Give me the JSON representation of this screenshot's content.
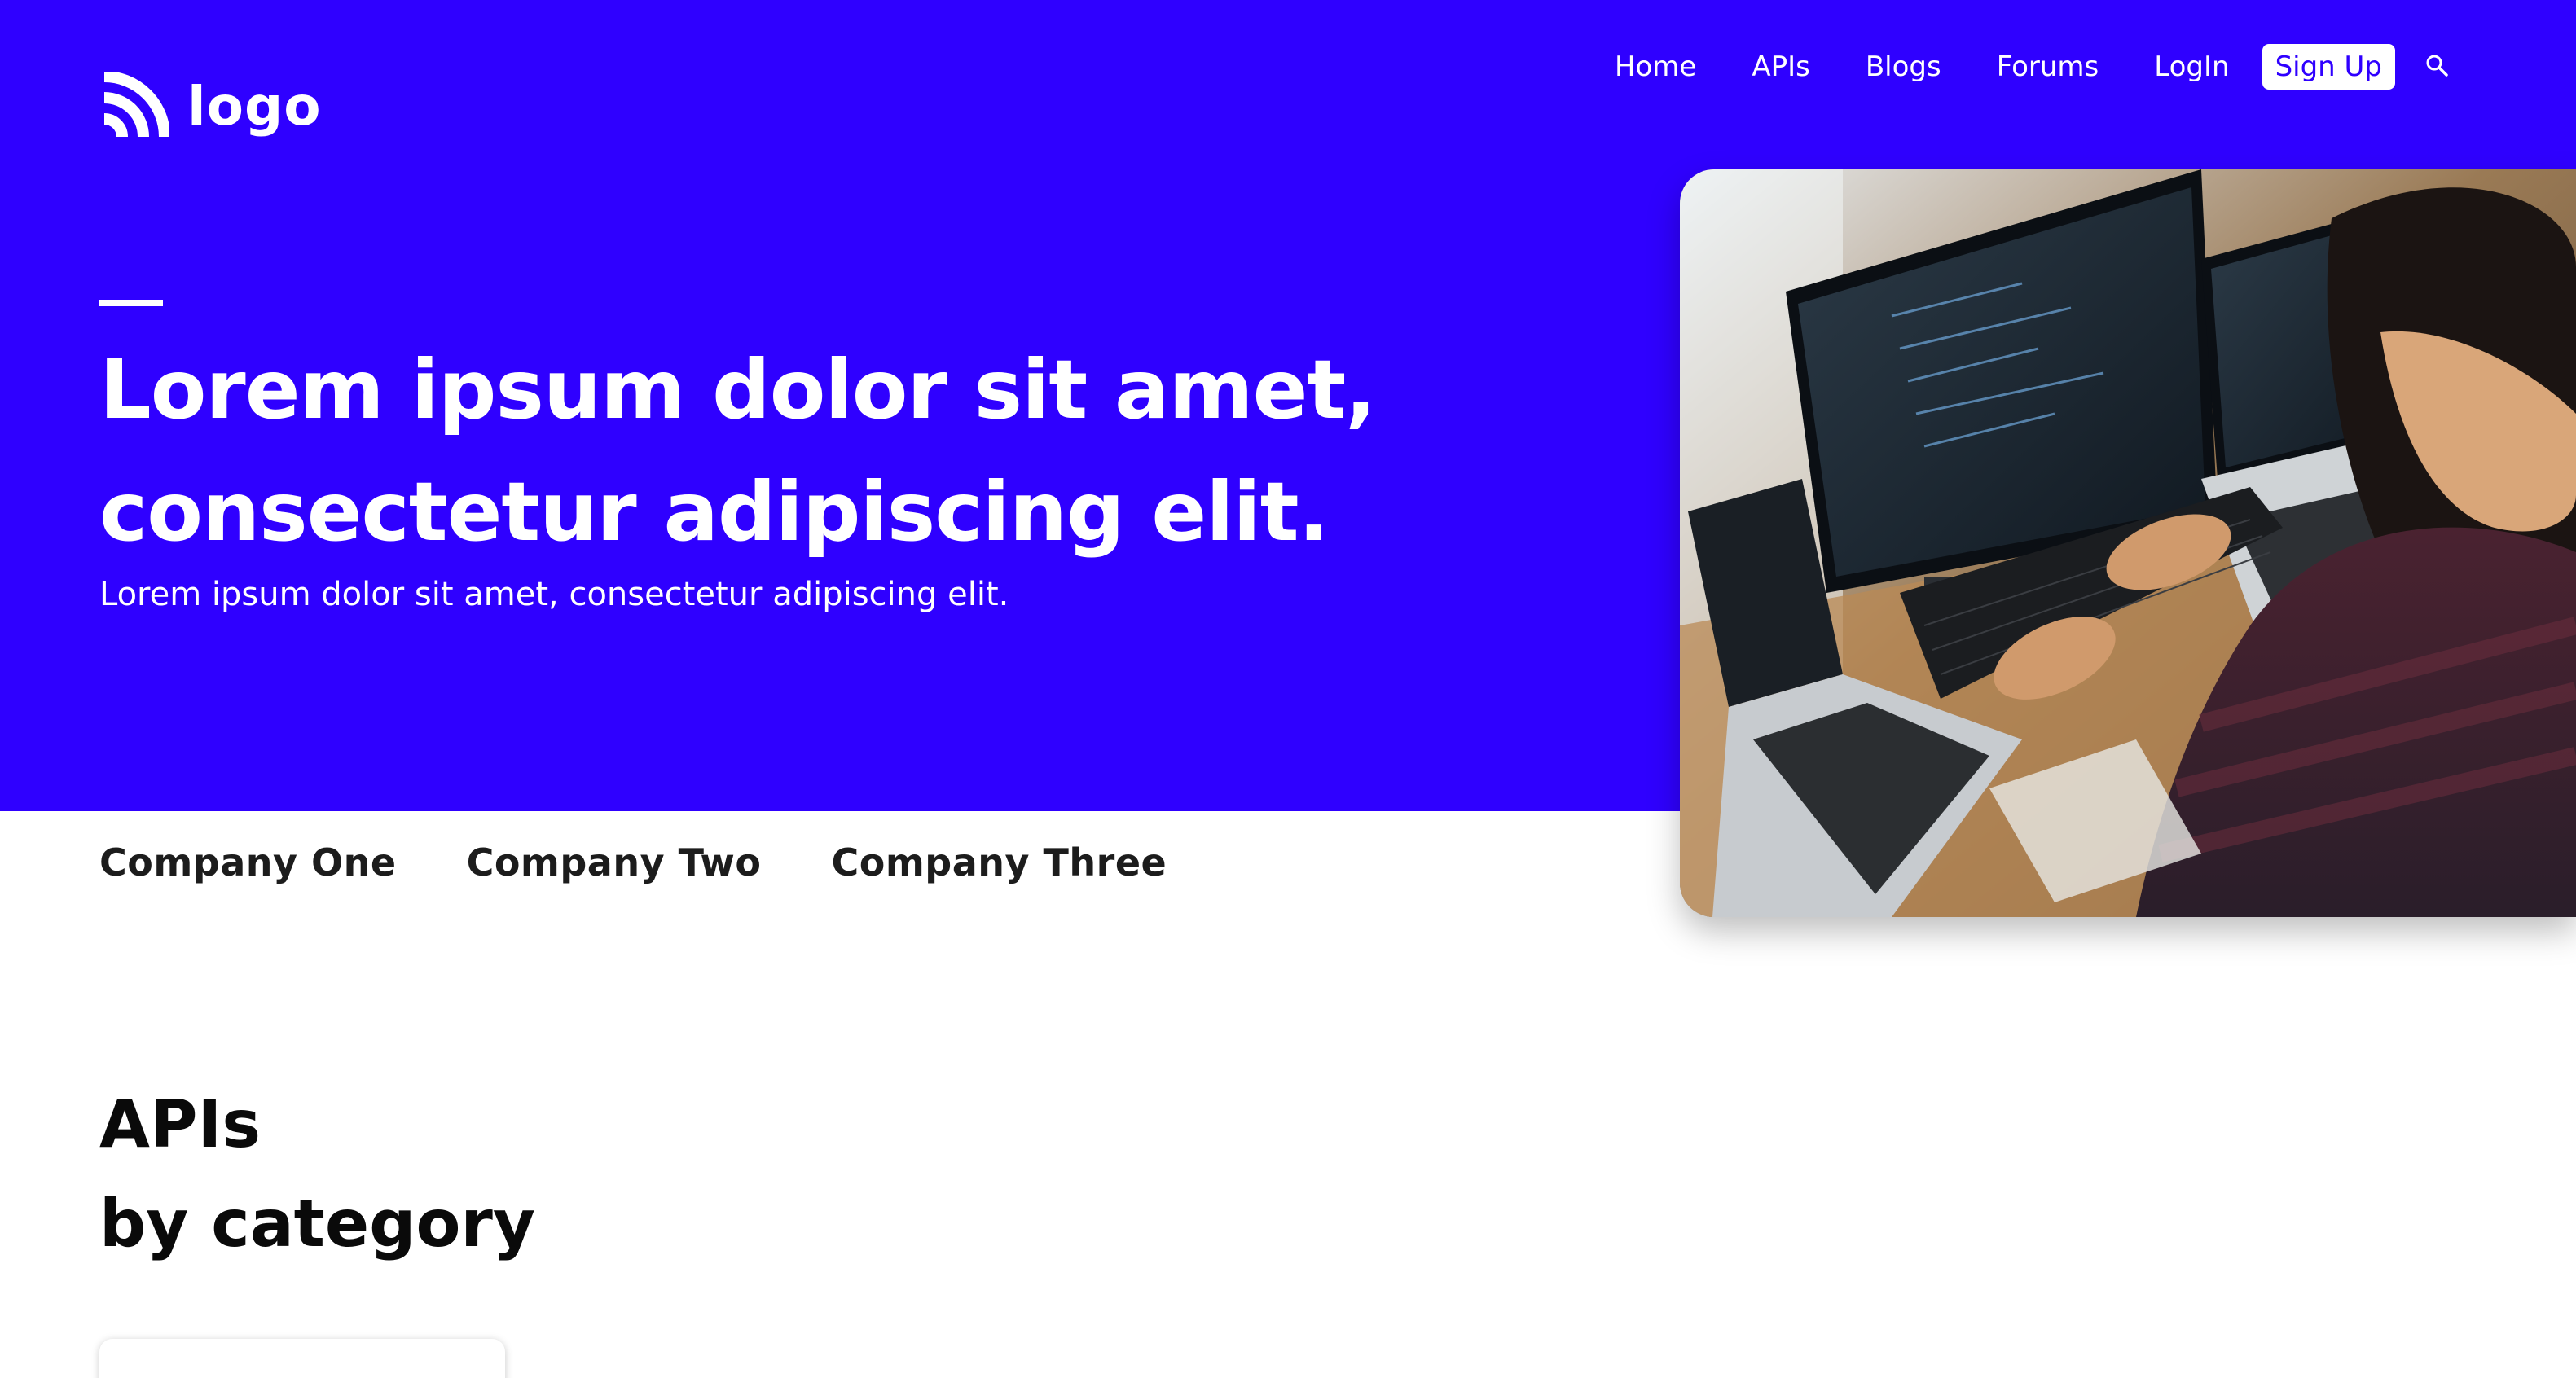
{
  "brand": {
    "logo_text": "logo",
    "accent": "#2f00ff"
  },
  "nav": {
    "items": [
      "Home",
      "APIs",
      "Blogs",
      "Forums",
      "LogIn"
    ],
    "signup_label": "Sign Up",
    "search_icon": "search-icon"
  },
  "hero": {
    "headline_line1": "Lorem ipsum dolor sit amet,",
    "headline_line2": "consectetur adipiscing elit.",
    "subtitle": "Lorem ipsum dolor sit amet, consectetur adipiscing elit.",
    "image": "developer-at-computers-photo"
  },
  "companies": [
    "Company One",
    "Company Two",
    "Company Three"
  ],
  "apis_section": {
    "title_line1": "APIs",
    "title_line2": "by category"
  }
}
